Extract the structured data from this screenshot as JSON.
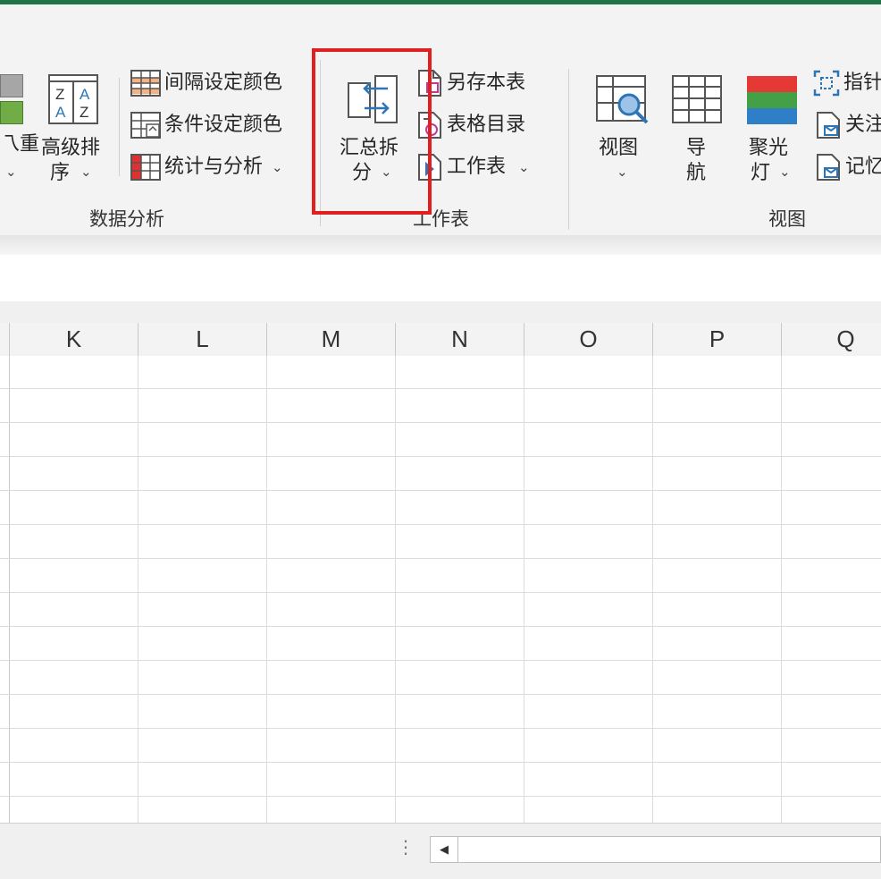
{
  "ribbon": {
    "groups": {
      "data_analysis": {
        "label": "数据分析",
        "partial_button": {
          "line1": "乁重",
          "chevron": "⌄"
        },
        "advanced_sort": {
          "line1": "高级排",
          "line2": "序",
          "chevron": "⌄"
        },
        "interval_color": "间隔设定颜色",
        "condition_color": "条件设定颜色",
        "stats_analysis": "统计与分析",
        "stats_chevron": "⌄"
      },
      "worksheet": {
        "label": "工作表",
        "summary_split": {
          "line1": "汇总拆",
          "line2": "分",
          "chevron": "⌄"
        },
        "save_sheet": "另存本表",
        "table_catalog": "表格目录",
        "worksheet_menu": "工作表",
        "worksheet_chevron": "⌄"
      },
      "view": {
        "label": "视图",
        "view_button": {
          "line1": "视图",
          "chevron": "⌄"
        },
        "navigate": {
          "line1": "导",
          "line2": "航"
        },
        "spotlight": {
          "line1": "聚光",
          "line2": "灯",
          "chevron": "⌄"
        },
        "pointer": "指针",
        "follow": "关注",
        "memo": "记忆"
      }
    }
  },
  "grid": {
    "columns": [
      "K",
      "L",
      "M",
      "N",
      "O",
      "P",
      "Q"
    ]
  },
  "statusbar": {
    "dots": "⋮",
    "scroll_left": "◀"
  },
  "colors": {
    "accent_green": "#217346",
    "highlight_red": "#e02020"
  }
}
